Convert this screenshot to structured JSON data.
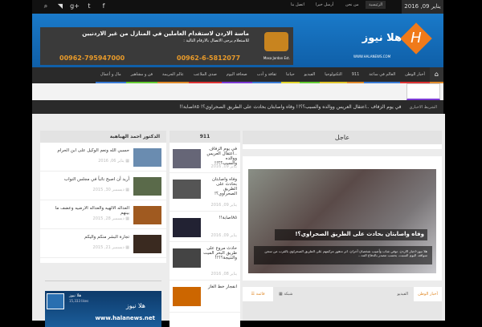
{
  "topbar": {
    "date": "يناير 09, 2016",
    "links": [
      "الرئيسية",
      "من نحن",
      "أرسل خبرا",
      "اتصل بنا"
    ],
    "social_icons": [
      "facebook-icon",
      "twitter-icon",
      "google-plus-icon",
      "rss-icon",
      "search-icon"
    ]
  },
  "banner": {
    "logo_text": "هلا نيوز",
    "logo_url": "WWW.HALANEWS.COM",
    "ad_title": "ماسة الاردن لاستقدام العاملين في المنازل من غير الاردنيين",
    "ad_sub": "للاستعلام يرجى الاتصال بالارقام التالية :",
    "phone1": "00962-795947000",
    "phone2": "00962-6-5812077",
    "ad_brand": "Masa Jordan Est."
  },
  "nav": [
    {
      "label": "أخبار الوطن",
      "color": "#d33"
    },
    {
      "label": "العالم في ساعة",
      "color": "#3a7bd5"
    },
    {
      "label": "911",
      "color": "#e08a2a"
    },
    {
      "label": "التكنولوجيا",
      "color": "#e0c52a"
    },
    {
      "label": "الفيديو",
      "color": "#6c3"
    },
    {
      "label": "حياتنا",
      "color": "#e0d32a"
    },
    {
      "label": "ثقافة و أدب",
      "color": "#3a7bd5"
    },
    {
      "label": "صحافة اليوم",
      "color": "#7b3ad5"
    },
    {
      "label": "صدى الملاعب",
      "color": "#d33"
    },
    {
      "label": "عالم الجريمة",
      "color": "#e08a2a"
    },
    {
      "label": "فن و مشاهير",
      "color": "#6c3"
    },
    {
      "label": "مال و أعمال",
      "color": "#3a7bd5"
    }
  ],
  "ticker": {
    "label": "الشريط الاخباري",
    "text": "في يوم الزفاف ..اعتقال العريس ووالده والسبب؟؟!! وفاه واصابتان بحادث على الطريق الصحراوي؟!  ٨٥اصابة!!"
  },
  "urgent": {
    "heading": "عاجل",
    "title": "وفاه واصابتان بحادث على الطريق الصحراوي؟!",
    "excerpt": "هلا نيوز-اخبار الاردن. توفي شاب وأصيب شخصان آخران. اثر تدهور مركبتهم على الطريق الصحراوي بالقرب من سجن سواقة، اليوم السبت، بحسب مصدر بالدفاع المد..."
  },
  "tabs": {
    "items": [
      "أخبار الوطن",
      "الفيديو"
    ],
    "grid": "شبكة",
    "list": "قائمة"
  },
  "col911": {
    "heading": "911",
    "items": [
      {
        "title": "في يوم الزفاف ..اعتقال العريس ووالده والسبب؟؟!!",
        "date": "يناير 09, 2016"
      },
      {
        "title": "وفاه واصابتان بحادث على الطريق الصحراوي؟!",
        "date": "يناير 09, 2016"
      },
      {
        "title": "٨٥اصابة!!",
        "date": "يناير 09, 2016"
      },
      {
        "title": "حادث مروع على طريق البحر الميت والنتيجة؟؟!!",
        "date": "يناير 08, 2016"
      },
      {
        "title": "انفجار خط الغاز",
        "date": ""
      }
    ]
  },
  "author": {
    "heading": "الدكتور احمد الهباهبة",
    "items": [
      {
        "title": "حسبي الله ونعم الوكيل على ابن الحرام",
        "date": "يناير 06, 2016"
      },
      {
        "title": "أريد أن اصبح نائباً في مجلس النواب",
        "date": "ديسمبر 30, 2015"
      },
      {
        "title": "العداله الالهيه والعداله الارضيه وعضف ما بينهم",
        "date": "ديسمبر 28, 2015"
      },
      {
        "title": "تجارة البشر منكم واليكم",
        "date": "ديسمبر 21, 2015"
      }
    ]
  },
  "fb": {
    "name": "هلا نيوز",
    "likes": "15,333 likes",
    "site": "www.halanews.net"
  }
}
